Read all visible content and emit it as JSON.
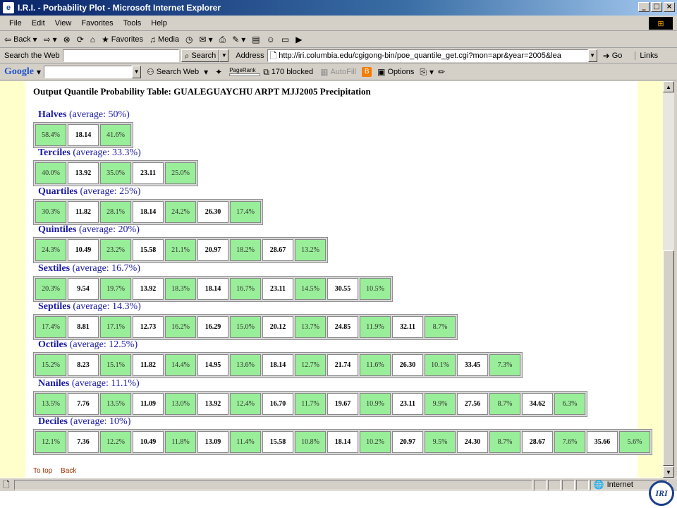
{
  "window": {
    "title": "I.R.I. - Porbability Plot - Microsoft Internet Explorer"
  },
  "menu": [
    "File",
    "Edit",
    "View",
    "Favorites",
    "Tools",
    "Help"
  ],
  "toolbar": {
    "back": "Back",
    "favorites": "Favorites",
    "media": "Media"
  },
  "address": {
    "search_label": "Search the Web",
    "search_btn": "Search",
    "label": "Address",
    "url": "http://iri.columbia.edu/cgigong-bin/poe_quantile_get.cgi?mon=apr&year=2005&lea",
    "go": "Go",
    "links": "Links"
  },
  "googlebar": {
    "brand": "Google",
    "search_web": "Search Web",
    "pagerank": "PageRank",
    "blocked": "170 blocked",
    "autofill": "AutoFill",
    "options": "Options"
  },
  "page": {
    "title": "Output Quantile Probability Table: GUALEGUAYCHU ARPT MJJ2005 Precipitation",
    "groups": [
      {
        "name": "Halves",
        "avg": "(average: 50%)",
        "cells": [
          "58.4%",
          "18.14",
          "41.6%"
        ]
      },
      {
        "name": "Terciles",
        "avg": "(average: 33.3%)",
        "cells": [
          "40.0%",
          "13.92",
          "35.0%",
          "23.11",
          "25.0%"
        ]
      },
      {
        "name": "Quartiles",
        "avg": "(average: 25%)",
        "cells": [
          "30.3%",
          "11.82",
          "28.1%",
          "18.14",
          "24.2%",
          "26.30",
          "17.4%"
        ]
      },
      {
        "name": "Quintiles",
        "avg": "(average: 20%)",
        "cells": [
          "24.3%",
          "10.49",
          "23.2%",
          "15.58",
          "21.1%",
          "20.97",
          "18.2%",
          "28.67",
          "13.2%"
        ]
      },
      {
        "name": "Sextiles",
        "avg": "(average: 16.7%)",
        "cells": [
          "20.3%",
          "9.54",
          "19.7%",
          "13.92",
          "18.3%",
          "18.14",
          "16.7%",
          "23.11",
          "14.5%",
          "30.55",
          "10.5%"
        ]
      },
      {
        "name": "Septiles",
        "avg": "(average: 14.3%)",
        "cells": [
          "17.4%",
          "8.81",
          "17.1%",
          "12.73",
          "16.2%",
          "16.29",
          "15.0%",
          "20.12",
          "13.7%",
          "24.85",
          "11.9%",
          "32.11",
          "8.7%"
        ]
      },
      {
        "name": "Octiles",
        "avg": "(average: 12.5%)",
        "cells": [
          "15.2%",
          "8.23",
          "15.1%",
          "11.82",
          "14.4%",
          "14.95",
          "13.6%",
          "18.14",
          "12.7%",
          "21.74",
          "11.6%",
          "26.30",
          "10.1%",
          "33.45",
          "7.3%"
        ]
      },
      {
        "name": "Naniles",
        "avg": "(average: 11.1%)",
        "cells": [
          "13.5%",
          "7.76",
          "13.5%",
          "11.09",
          "13.0%",
          "13.92",
          "12.4%",
          "16.70",
          "11.7%",
          "19.67",
          "10.9%",
          "23.11",
          "9.9%",
          "27.56",
          "8.7%",
          "34.62",
          "6.3%"
        ]
      },
      {
        "name": "Deciles",
        "avg": "(average: 10%)",
        "cells": [
          "12.1%",
          "7.36",
          "12.2%",
          "10.49",
          "11.8%",
          "13.09",
          "11.4%",
          "15.58",
          "10.8%",
          "18.14",
          "10.2%",
          "20.97",
          "9.5%",
          "24.30",
          "8.7%",
          "28.67",
          "7.6%",
          "35.66",
          "5.6%"
        ]
      }
    ],
    "links": [
      "To top",
      "Back"
    ]
  },
  "status": {
    "zone": "Internet"
  },
  "logo": "IRI"
}
